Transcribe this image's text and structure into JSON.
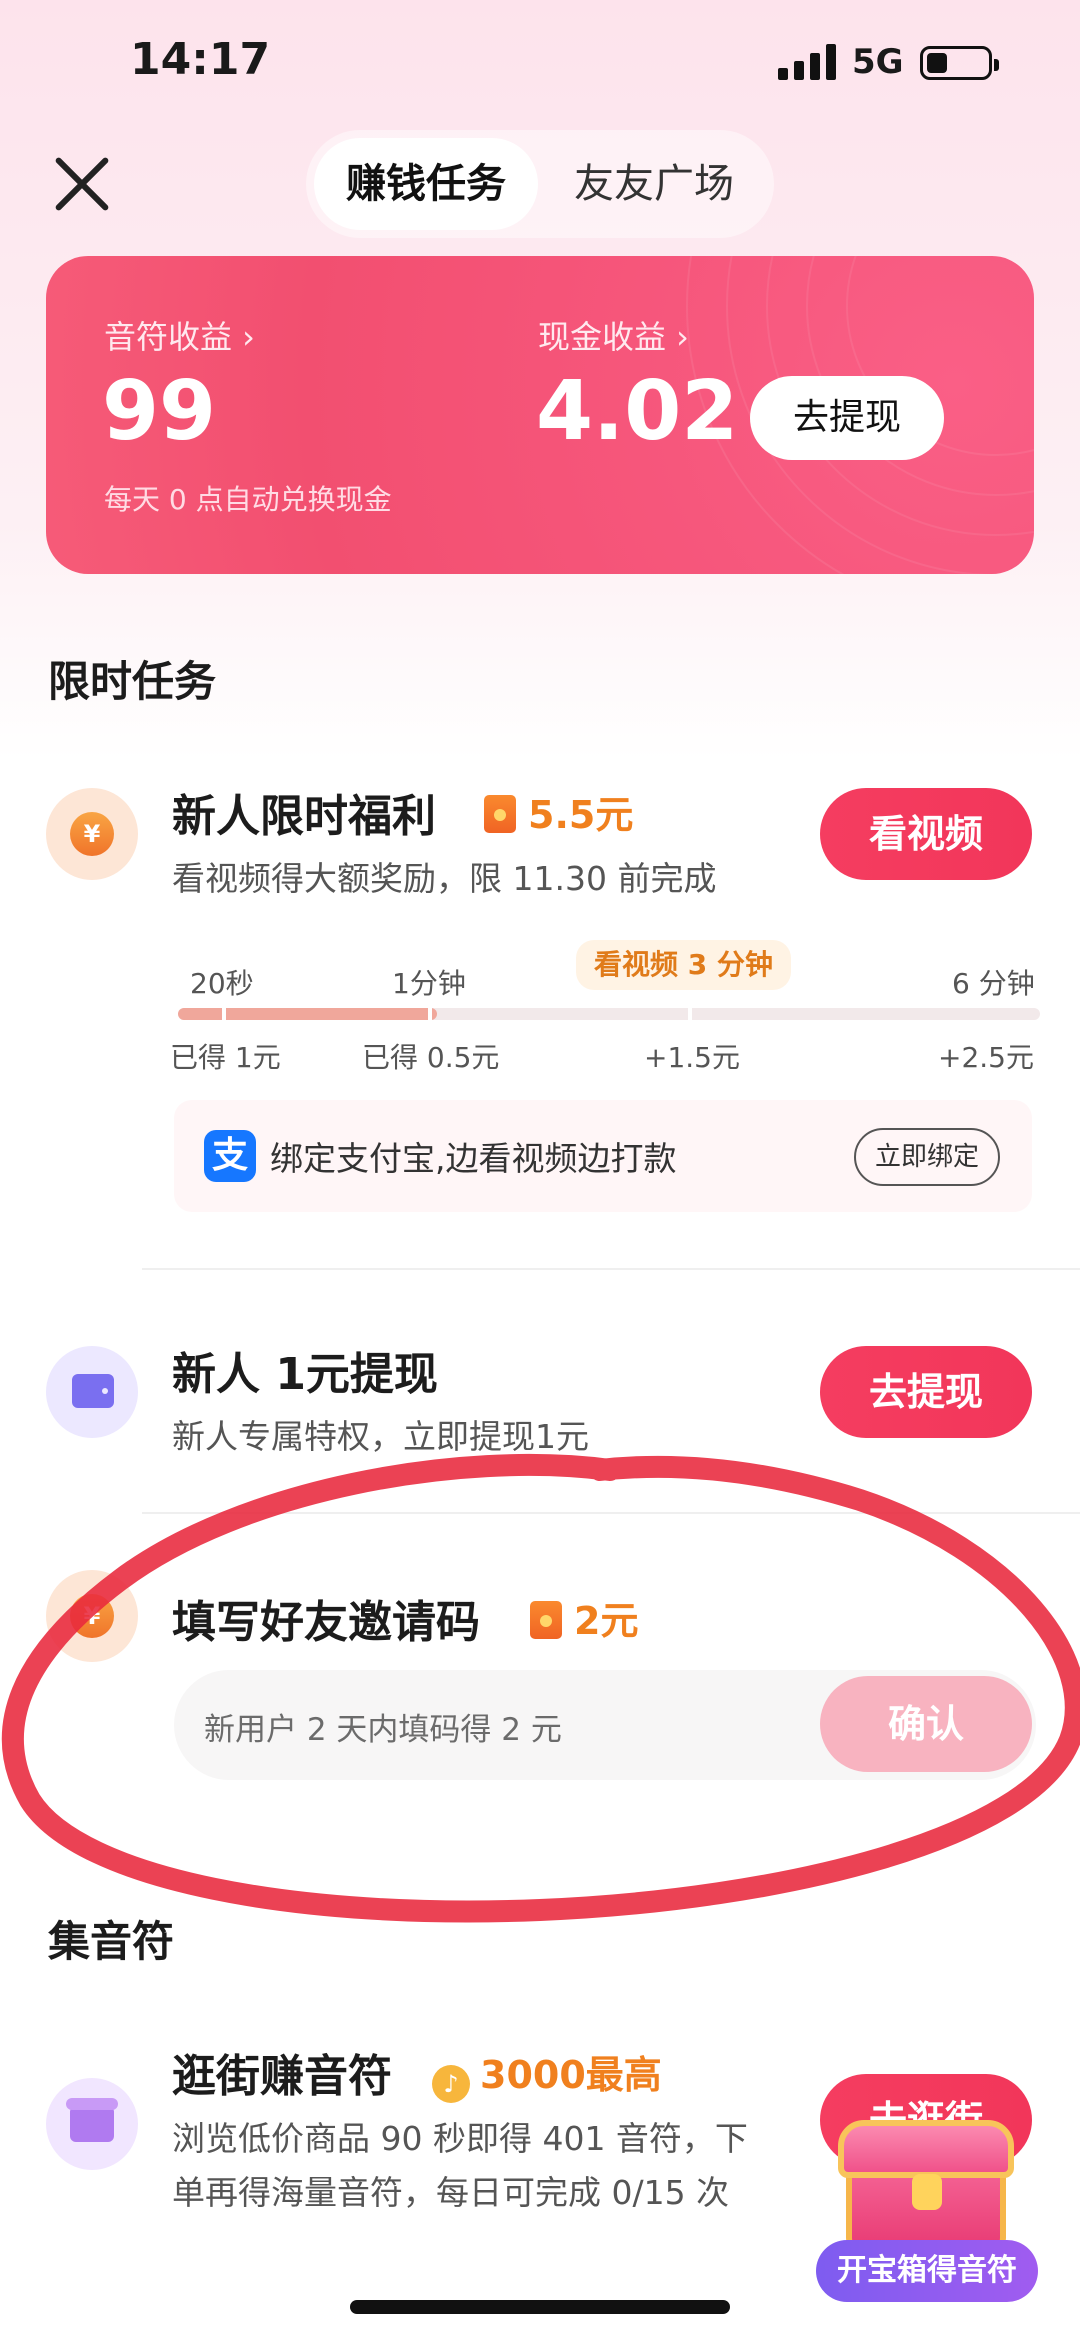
{
  "status_bar": {
    "time": "14:17",
    "network": "5G"
  },
  "header": {
    "tabs": [
      {
        "label": "赚钱任务",
        "active": true
      },
      {
        "label": "友友广场",
        "active": false
      }
    ]
  },
  "earnings": {
    "note_label": "音符收益 ›",
    "note_value": "99",
    "note_sub": "每天 0 点自动兑换现金",
    "cash_label": "现金收益 ›",
    "cash_value": "4.02",
    "withdraw_label": "去提现"
  },
  "limited_section": {
    "title": "限时任务"
  },
  "task_newbie": {
    "title": "新人限时福利",
    "reward": "5.5元",
    "desc": "看视频得大额奖励，限 11.30 前完成",
    "button": "看视频",
    "progress": {
      "fill_fraction": 0.3,
      "steps": [
        {
          "top": "20秒",
          "bottom": "已得 1元"
        },
        {
          "top": "1分钟",
          "bottom": "已得 0.5元"
        },
        {
          "top": "看视频 3 分钟",
          "bottom": "+1.5元"
        },
        {
          "top": "6 分钟",
          "bottom": "+2.5元"
        }
      ]
    },
    "alipay": {
      "icon": "支",
      "text": "绑定支付宝,边看视频边打款",
      "button": "立即绑定"
    }
  },
  "task_withdraw": {
    "title": "新人 1元提现",
    "desc": "新人专属特权，立即提现1元",
    "button": "去提现"
  },
  "task_invite": {
    "title": "填写好友邀请码",
    "reward": "2元",
    "placeholder": "新用户 2 天内填码得 2 元",
    "button": "确认"
  },
  "notes_section": {
    "title": "集音符"
  },
  "task_shop": {
    "title": "逛街赚音符",
    "reward": "3000最高",
    "desc_line1": "浏览低价商品 90 秒即得 401 音符，下",
    "desc_line2": "单再得海量音符，每日可完成 0/15 次",
    "button": "去逛街"
  },
  "chest": {
    "label": "开宝箱得音符"
  },
  "colors": {
    "accent": "#f2365a",
    "card": "#f24f70",
    "reward": "#f0801e",
    "annotation": "#e8283c"
  }
}
